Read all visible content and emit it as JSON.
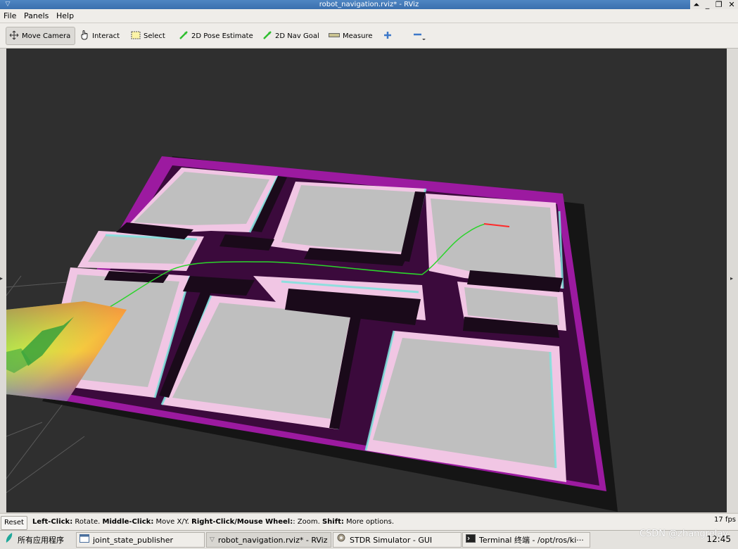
{
  "window": {
    "title": "robot_navigation.rviz* - RViz",
    "controls": [
      "⏶",
      "_",
      "❐",
      "✕"
    ]
  },
  "menu": {
    "file": "File",
    "panels": "Panels",
    "help": "Help"
  },
  "toolbar": {
    "move_camera": "Move Camera",
    "interact": "Interact",
    "select": "Select",
    "pose_estimate": "2D Pose Estimate",
    "nav_goal": "2D Nav Goal",
    "measure": "Measure"
  },
  "status": {
    "reset": "Reset",
    "hint_left_key": "Left-Click:",
    "hint_left": " Rotate. ",
    "hint_middle_key": "Middle-Click:",
    "hint_middle": " Move X/Y. ",
    "hint_right_key": "Right-Click/Mouse Wheel:",
    "hint_right": ": Zoom. ",
    "hint_shift_key": "Shift:",
    "hint_shift": " More options.",
    "fps": "17 fps"
  },
  "taskbar": {
    "apps_menu": "所有应用程序",
    "tasks": [
      "joint_state_publisher",
      "robot_navigation.rviz* - RViz",
      "STDR Simulator - GUI",
      "Terminal 终端 - /opt/ros/ki···"
    ],
    "clock": "12:45"
  },
  "watermark": "CSDN @zhangrelay"
}
